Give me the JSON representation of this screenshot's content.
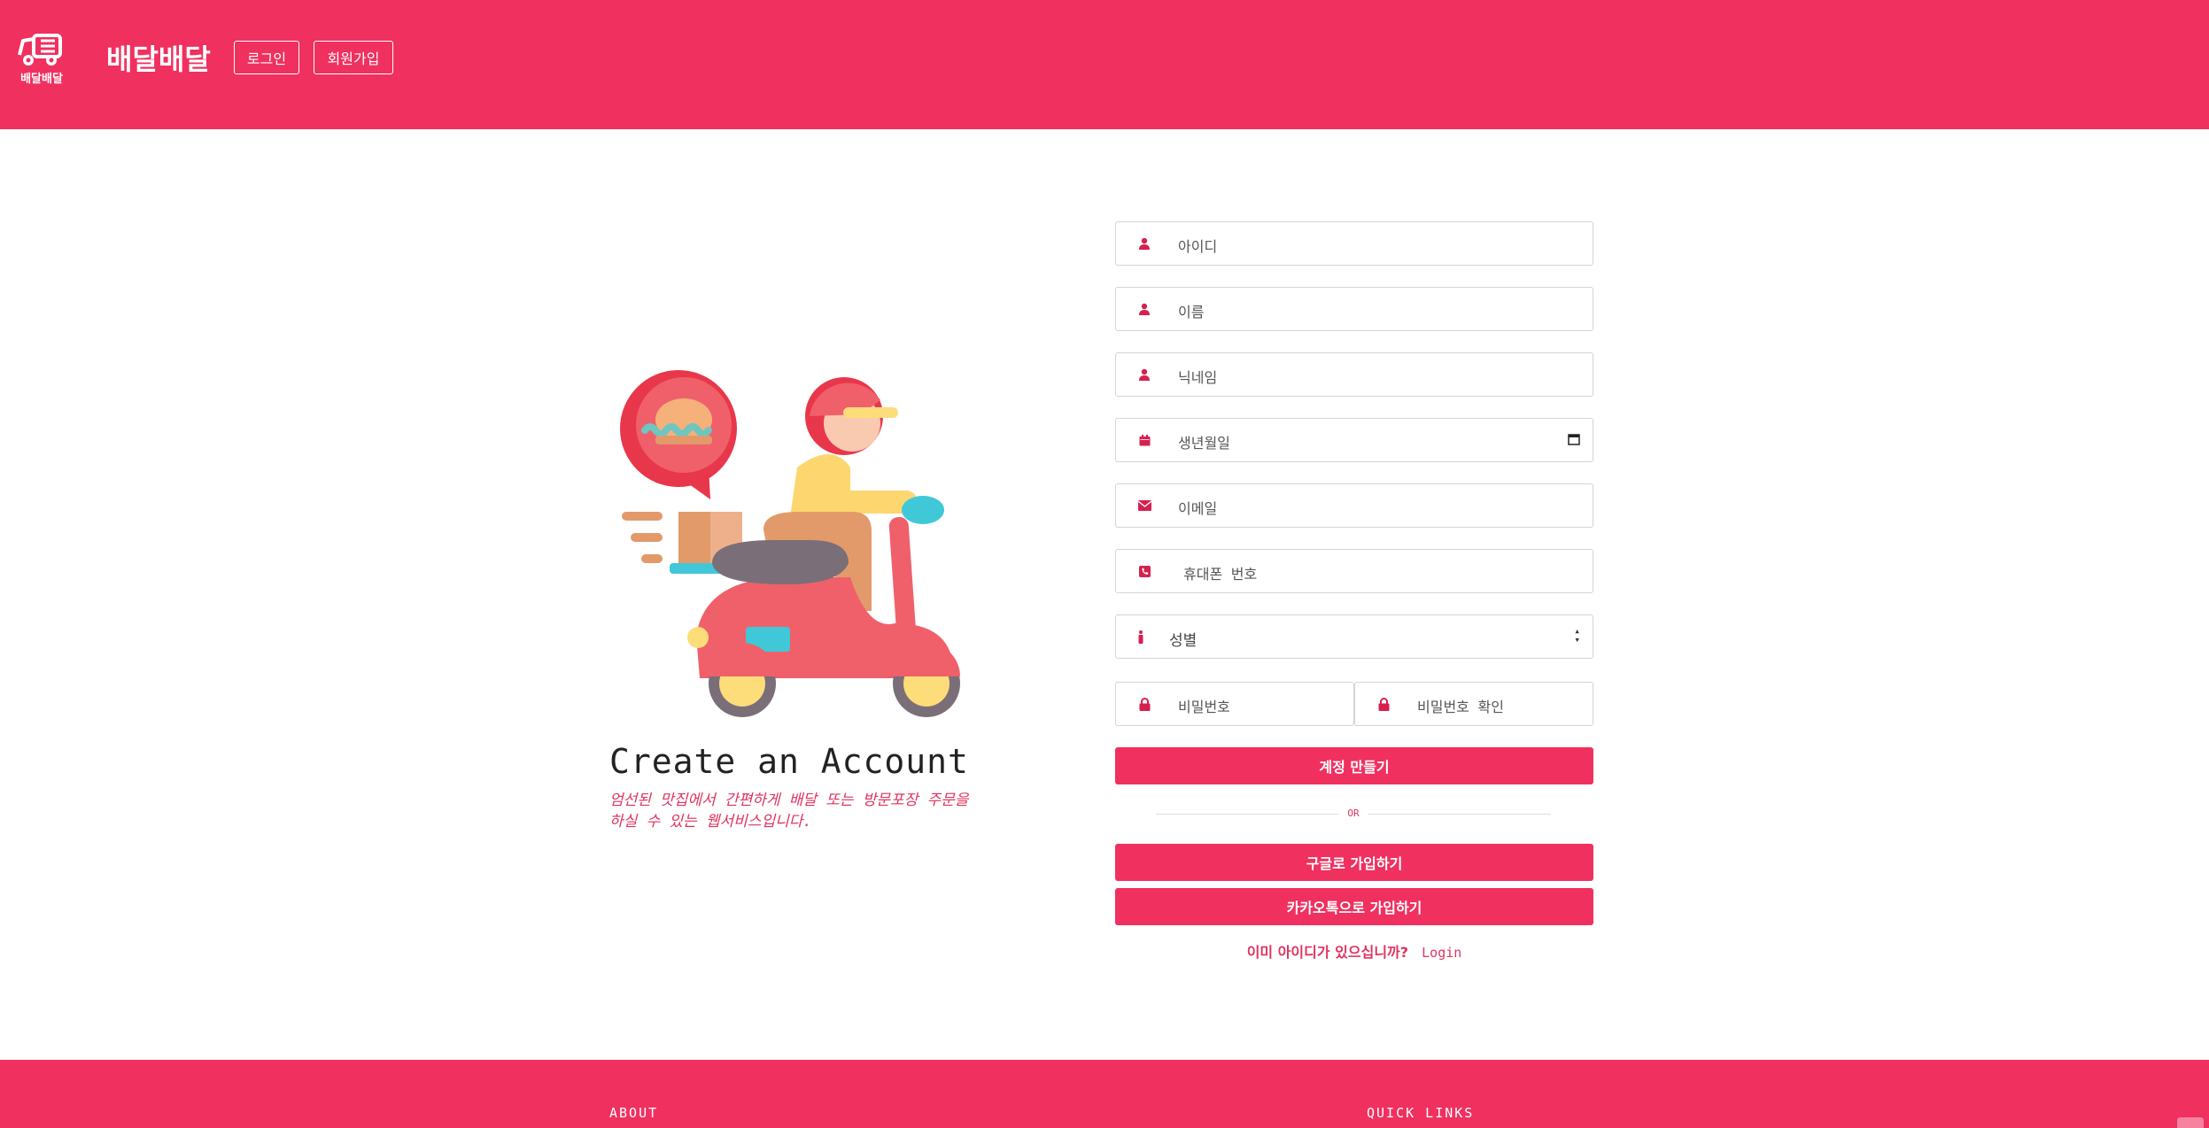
{
  "header": {
    "logo_text": "배달배달",
    "brand": "배달배달",
    "nav_login": "로그인",
    "nav_signup": "회원가입",
    "accent_color": "#f0305f"
  },
  "intro": {
    "title": "Create an Account",
    "subtitle": "엄선된 맛집에서 간편하게 배달 또는 방문포장 주문을 하실 수 있는 웹서비스입니다.",
    "illustration_icon": "scooter-delivery-icon"
  },
  "form": {
    "id_placeholder": "아이디",
    "name_placeholder": "이름",
    "nickname_placeholder": "닉네임",
    "birthdate_placeholder": "생년월일",
    "email_placeholder": "이메일",
    "phone_placeholder": "휴대폰 번호",
    "gender_selected": "성별",
    "password_placeholder": "비밀번호",
    "password_confirm_placeholder": "비밀번호 확인",
    "create_button": "계정 만들기",
    "or_text": "OR",
    "google_button": "구글로 가입하기",
    "kakao_button": "카카오톡으로 가입하기",
    "already_text": "이미 아이디가 있으십니까?",
    "login_link": "Login"
  },
  "footer": {
    "about_heading": "ABOUT",
    "links_heading": "QUICK LINKS"
  }
}
